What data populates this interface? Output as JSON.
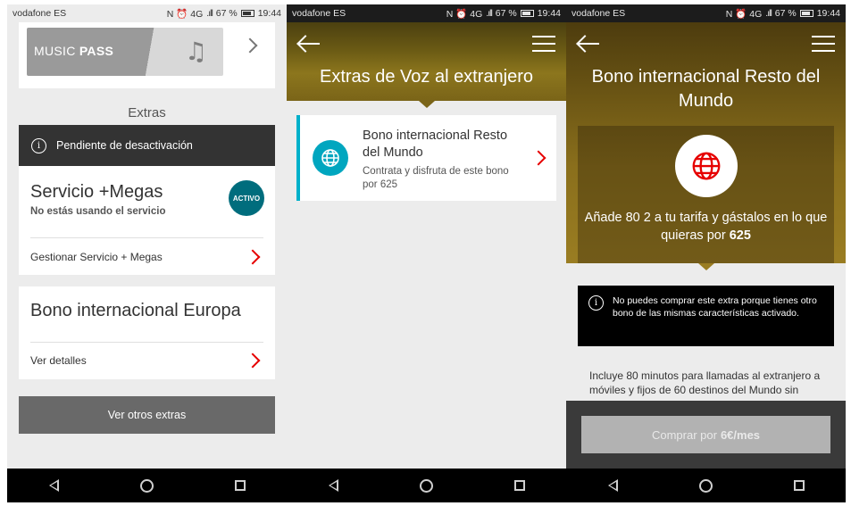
{
  "status": {
    "carrier": "vodafone ES",
    "icons": "N ⏰ 4G",
    "battery": "67 %",
    "time": "19:44"
  },
  "screen1": {
    "music_pass": {
      "part1": "MUSIC",
      "part2": "PASS",
      "icon": "music-note-icon"
    },
    "extras_title": "Extras",
    "pending_notice": "Pendiente de desactivación",
    "megas": {
      "title": "Servicio +Megas",
      "subtitle": "No estás usando el servicio",
      "badge": "ACTIVO",
      "link": "Gestionar Servicio + Megas"
    },
    "europa": {
      "title": "Bono internacional Europa",
      "link": "Ver detalles"
    },
    "more_button": "Ver otros extras"
  },
  "screen2": {
    "title": "Extras de Voz al extranjero",
    "bono": {
      "title": "Bono internacional Resto del Mundo",
      "description": "Contrata y disfruta de este bono por 625",
      "icon": "globe-icon"
    }
  },
  "screen3": {
    "title": "Bono internacional Resto del Mundo",
    "desc_prefix": "Añade 80 2 a tu tarifa y gástalos en lo que quieras por",
    "desc_price": "625",
    "warning": "No puedes comprar este extra porque tienes otro bono de las mismas características activado.",
    "body": "Incluye 80 minutos para llamadas al extranjero a móviles y fijos de 60 destinos del Mundo sin",
    "buy_prefix": "Comprar por",
    "buy_price": "6€/mes"
  },
  "colors": {
    "vodafone_red": "#e60000",
    "teal": "#00a6bf",
    "badge_teal": "#006d7d"
  }
}
